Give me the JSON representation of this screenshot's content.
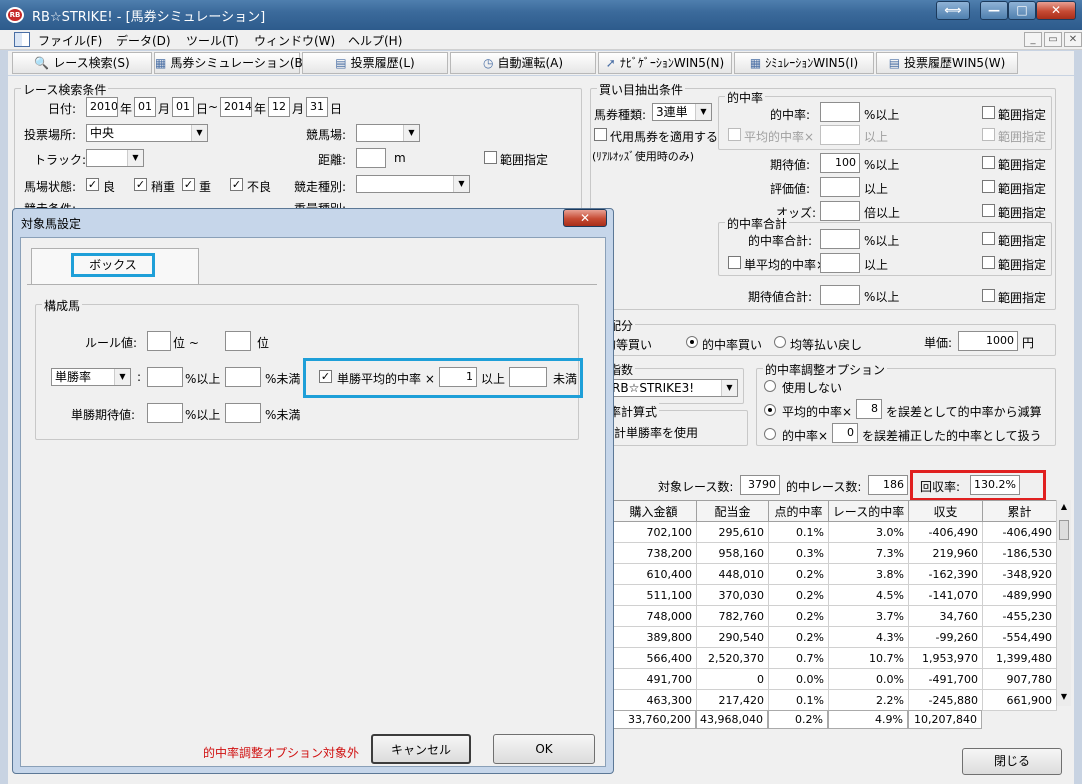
{
  "window": {
    "title": "RB☆STRIKE! - [馬券シミュレーション]",
    "icon": "rb-app-icon",
    "max_glyph": "⟺",
    "min_glyph": "—",
    "restore_glyph": "□",
    "close_glyph": "✕"
  },
  "menu": {
    "items": [
      "ファイル(F)",
      "データ(D)",
      "ツール(T)",
      "ウィンドウ(W)",
      "ヘルプ(H)"
    ],
    "mdi_min": "_",
    "mdi_restore": "▭",
    "mdi_close": "✕"
  },
  "toolbar": [
    {
      "label": "レース検索(S)",
      "icon": "magnifier-icon",
      "glyph": "🔍"
    },
    {
      "label": "馬券シミュレーション(B)",
      "icon": "grid-icon",
      "glyph": "▦"
    },
    {
      "label": "投票履歴(L)",
      "icon": "document-icon",
      "glyph": "▤"
    },
    {
      "label": "自動運転(A)",
      "icon": "clock-icon",
      "glyph": "◷"
    },
    {
      "label": "ﾅﾋﾞｹﾞｰｼｮﾝWIN5(N)",
      "icon": "arrow-icon",
      "glyph": "➚"
    },
    {
      "label": "ｼﾐｭﾚｰｼｮﾝWIN5(I)",
      "icon": "grid-icon",
      "glyph": "▦"
    },
    {
      "label": "投票履歴WIN5(W)",
      "icon": "document-icon",
      "glyph": "▤"
    }
  ],
  "race_search": {
    "title": "レース検索条件",
    "date_label": "日付:",
    "from_year": "2010",
    "year": "年",
    "from_month": "01",
    "month": "月",
    "from_day": "01",
    "day": "日",
    "tilde": "~",
    "to_year": "2014",
    "to_month": "12",
    "to_day": "31",
    "venue_label": "投票場所:",
    "venue_value": "中央",
    "course_label": "競馬場:",
    "track_label": "トラック:",
    "distance_label": "距離:",
    "distance_unit": "m",
    "range_label": "範囲指定",
    "condition_label": "馬場状態:",
    "conditions": [
      "良",
      "稍重",
      "重",
      "不良"
    ],
    "race_type_label": "競走種別:",
    "race_cond_label": "競走条件:",
    "weight_label": "重量種別:"
  },
  "bet_cond": {
    "title": "買い目抽出条件",
    "type_label": "馬券種類:",
    "type_value": "3連単",
    "substitute_label": "代用馬券を適用する",
    "realtime_note": "(ﾘｱﾙｵｯｽﾞ使用時のみ)",
    "hit_rate_title": "的中率",
    "hit_rate_label": "的中率:",
    "hit_rate_unit": "%以上",
    "avg_hit_label": "平均的中率×",
    "avg_hit_unit": "以上",
    "range_label": "範囲指定",
    "expected_label": "期待値:",
    "expected_value": "100",
    "expected_unit": "%以上",
    "rating_label": "評価値:",
    "rating_unit": "以上",
    "odds_label": "オッズ:",
    "odds_unit": "倍以上",
    "total_title": "的中率合計",
    "total_label": "的中率合計:",
    "total_unit": "%以上",
    "single_avg_label": "単平均的中率×",
    "single_avg_unit": "以上",
    "exp_total_label": "期待値合計:",
    "exp_total_unit": "%以上"
  },
  "alloc": {
    "title": "配分",
    "opts": [
      "均等買い",
      "的中率買い",
      "均等払い戻し"
    ],
    "unit_label": "単価:",
    "unit_value": "1000",
    "unit_yen": "円"
  },
  "index": {
    "title": "指数",
    "value": "RB☆STRIKE3!"
  },
  "calc": {
    "title": "率計算式",
    "text": "計単勝率を使用"
  },
  "adjust": {
    "title": "的中率調整オプション",
    "opt1": "使用しない",
    "opt2_pre": "平均的中率×",
    "opt2_value": "8",
    "opt2_post": "を誤差として的中率から減算",
    "opt3_pre": "的中率×",
    "opt3_value": "0",
    "opt3_post": "を誤差補正した的中率として扱う"
  },
  "stats": {
    "races_label": "対象レース数:",
    "races": "3790",
    "hit_label": "的中レース数:",
    "hit": "186",
    "recovery_label": "回収率:",
    "recovery": "130.2%"
  },
  "table": {
    "headers": [
      "購入金額",
      "配当金",
      "点的中率",
      "レース的中率",
      "収支",
      "累計"
    ],
    "rows": [
      [
        "702,100",
        "295,610",
        "0.1%",
        "3.0%",
        "-406,490",
        "-406,490"
      ],
      [
        "738,200",
        "958,160",
        "0.3%",
        "7.3%",
        "219,960",
        "-186,530"
      ],
      [
        "610,400",
        "448,010",
        "0.2%",
        "3.8%",
        "-162,390",
        "-348,920"
      ],
      [
        "511,100",
        "370,030",
        "0.2%",
        "4.5%",
        "-141,070",
        "-489,990"
      ],
      [
        "748,000",
        "782,760",
        "0.2%",
        "3.7%",
        "34,760",
        "-455,230"
      ],
      [
        "389,800",
        "290,540",
        "0.2%",
        "4.3%",
        "-99,260",
        "-554,490"
      ],
      [
        "566,400",
        "2,520,370",
        "0.7%",
        "10.7%",
        "1,953,970",
        "1,399,480"
      ],
      [
        "491,700",
        "0",
        "0.0%",
        "0.0%",
        "-491,700",
        "907,780"
      ],
      [
        "463,300",
        "217,420",
        "0.1%",
        "2.2%",
        "-245,880",
        "661,900"
      ]
    ],
    "totals": [
      "33,760,200",
      "43,968,040",
      "0.2%",
      "4.9%",
      "10,207,840"
    ]
  },
  "close_button": "閉じる",
  "dialog": {
    "title": "対象馬設定",
    "close_glyph": "✕",
    "tab": "ボックス",
    "group_title": "構成馬",
    "rule_label": "ルール値:",
    "rank_from": "位 ~",
    "rank_to": "位",
    "metric_value": "単勝率",
    "colon": ":",
    "pct_more": "%以上",
    "pct_less": "%未満",
    "single_avg_label": "単勝平均的中率 ×",
    "single_avg_value": "1",
    "single_avg_more": "以上",
    "single_avg_less": "未満",
    "win_exp_label": "単勝期待値:",
    "note": "的中率調整オプション対象外",
    "cancel": "キャンセル",
    "ok": "OK"
  }
}
